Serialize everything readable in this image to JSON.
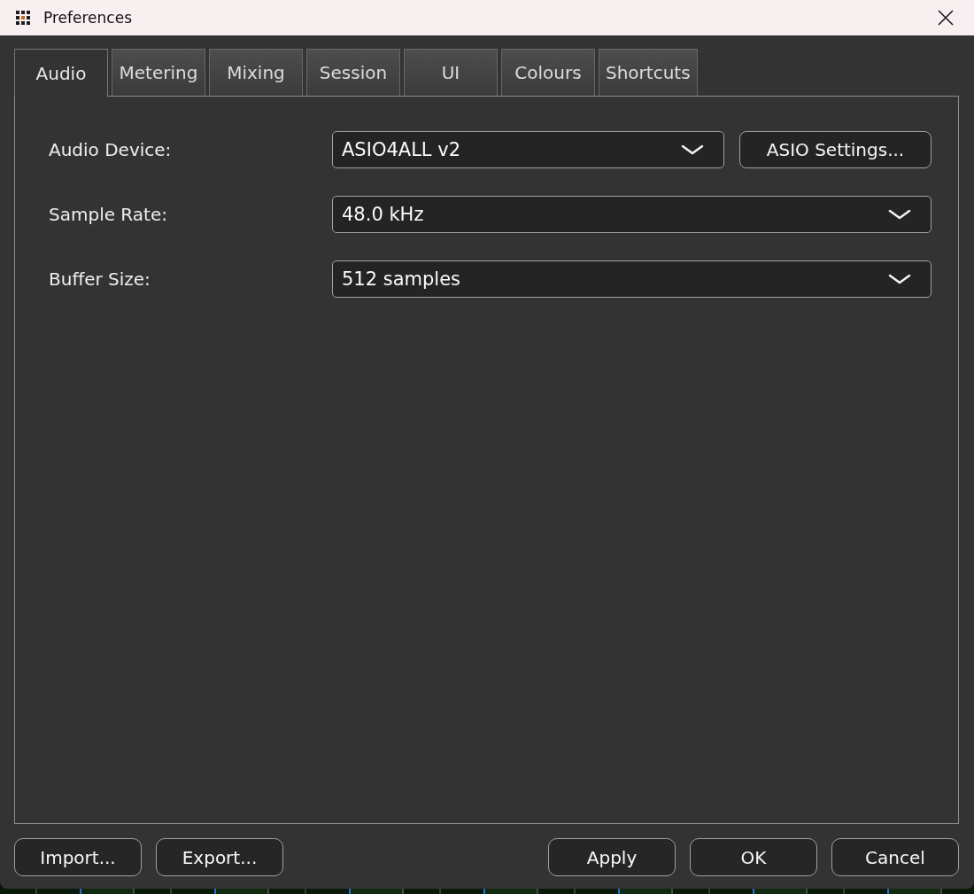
{
  "window": {
    "title": "Preferences"
  },
  "tabs": [
    {
      "label": "Audio",
      "selected": true
    },
    {
      "label": "Metering",
      "selected": false
    },
    {
      "label": "Mixing",
      "selected": false
    },
    {
      "label": "Session",
      "selected": false
    },
    {
      "label": "UI",
      "selected": false
    },
    {
      "label": "Colours",
      "selected": false
    },
    {
      "label": "Shortcuts",
      "selected": false
    }
  ],
  "settings": [
    {
      "label": "Audio Device:",
      "value": "ASIO4ALL v2",
      "button": "ASIO Settings..."
    },
    {
      "label": "Sample Rate:",
      "value": "48.0 kHz"
    },
    {
      "label": "Buffer Size:",
      "value": "512 samples"
    }
  ],
  "footer": {
    "left_buttons": [
      "Import...",
      "Export..."
    ],
    "right_buttons": [
      "Apply",
      "OK",
      "Cancel"
    ]
  }
}
